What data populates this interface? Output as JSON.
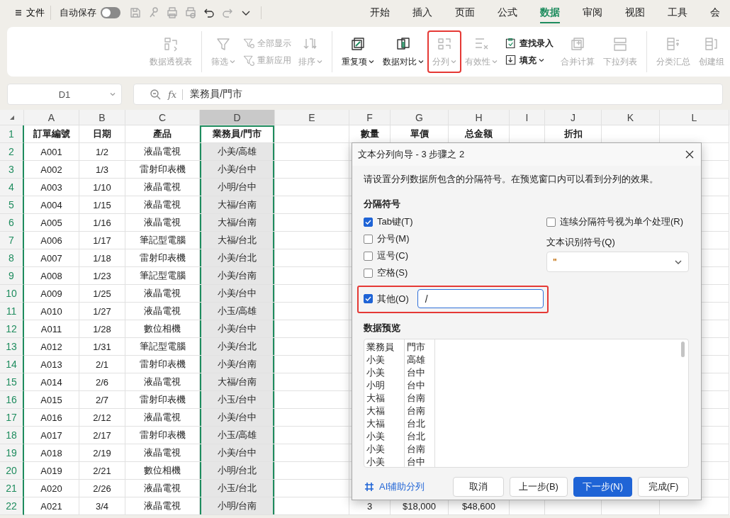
{
  "title_bar": {
    "file_label": "文件",
    "autosave": {
      "label": "自动保存",
      "on": false
    },
    "tabs": [
      {
        "label": "开始",
        "selected": false
      },
      {
        "label": "插入",
        "selected": false
      },
      {
        "label": "页面",
        "selected": false
      },
      {
        "label": "公式",
        "selected": false
      },
      {
        "label": "数据",
        "selected": true
      },
      {
        "label": "审阅",
        "selected": false
      },
      {
        "label": "视图",
        "selected": false
      },
      {
        "label": "工具",
        "selected": false
      },
      {
        "label": "会",
        "selected": false
      }
    ]
  },
  "ribbon": {
    "groups": [
      {
        "items": [
          {
            "kind": "large",
            "label": "数据透视表",
            "disabled": true,
            "caret": false,
            "highlighted": false
          }
        ]
      },
      {
        "items": [
          {
            "kind": "large",
            "label": "筛选",
            "disabled": true,
            "caret": true,
            "highlighted": false
          },
          {
            "kind": "stack",
            "entries": [
              {
                "label": "全部显示",
                "disabled": true,
                "caret": false
              },
              {
                "label": "重新应用",
                "disabled": true,
                "caret": false
              }
            ]
          },
          {
            "kind": "large",
            "label": "排序",
            "disabled": true,
            "caret": true,
            "highlighted": false
          }
        ]
      },
      {
        "items": [
          {
            "kind": "large",
            "label": "重复项",
            "disabled": false,
            "caret": true,
            "highlighted": false
          },
          {
            "kind": "large",
            "label": "数据对比",
            "disabled": false,
            "caret": true,
            "highlighted": false
          },
          {
            "kind": "large",
            "label": "分列",
            "disabled": true,
            "caret": true,
            "highlighted": true
          },
          {
            "kind": "large",
            "label": "有效性",
            "disabled": true,
            "caret": true,
            "highlighted": false
          },
          {
            "kind": "stack",
            "entries": [
              {
                "label": "查找录入",
                "disabled": false,
                "caret": false
              },
              {
                "label": "填充",
                "disabled": false,
                "caret": true
              }
            ]
          },
          {
            "kind": "large",
            "label": "合并计算",
            "disabled": true,
            "caret": false,
            "highlighted": false
          },
          {
            "kind": "large",
            "label": "下拉列表",
            "disabled": true,
            "caret": false,
            "highlighted": false
          }
        ]
      },
      {
        "items": [
          {
            "kind": "large",
            "label": "分类汇总",
            "disabled": true,
            "caret": false,
            "highlighted": false
          },
          {
            "kind": "large",
            "label": "创建组",
            "disabled": true,
            "caret": false,
            "highlighted": false
          }
        ]
      }
    ]
  },
  "formula_bar": {
    "cell_ref": "D1",
    "fx": "fx",
    "value": "業務員/門市"
  },
  "sheet": {
    "columns": [
      {
        "label": "A",
        "selected": false
      },
      {
        "label": "B",
        "selected": false
      },
      {
        "label": "C",
        "selected": false
      },
      {
        "label": "D",
        "selected": true
      },
      {
        "label": "E",
        "selected": false
      },
      {
        "label": "F",
        "selected": false
      },
      {
        "label": "G",
        "selected": false
      },
      {
        "label": "H",
        "selected": false
      },
      {
        "label": "I",
        "selected": false
      },
      {
        "label": "J",
        "selected": false
      },
      {
        "label": "K",
        "selected": false
      },
      {
        "label": "L",
        "selected": false
      }
    ],
    "rows": [
      {
        "number": "1",
        "cells": [
          "訂單編號",
          "日期",
          "產品",
          "業務員/門市",
          null,
          "數量",
          "單價",
          "总金额",
          null,
          "折扣"
        ]
      },
      {
        "number": "2",
        "cells": [
          "A001",
          "1/2",
          "液晶電視",
          "小美/高雄"
        ]
      },
      {
        "number": "3",
        "cells": [
          "A002",
          "1/3",
          "雷射印表機",
          "小美/台中"
        ]
      },
      {
        "number": "4",
        "cells": [
          "A003",
          "1/10",
          "液晶電視",
          "小明/台中"
        ]
      },
      {
        "number": "5",
        "cells": [
          "A004",
          "1/15",
          "液晶電視",
          "大福/台南"
        ]
      },
      {
        "number": "6",
        "cells": [
          "A005",
          "1/16",
          "液晶電視",
          "大福/台南"
        ]
      },
      {
        "number": "7",
        "cells": [
          "A006",
          "1/17",
          "筆記型電腦",
          "大福/台北"
        ]
      },
      {
        "number": "8",
        "cells": [
          "A007",
          "1/18",
          "雷射印表機",
          "小美/台北"
        ]
      },
      {
        "number": "9",
        "cells": [
          "A008",
          "1/23",
          "筆記型電腦",
          "小美/台南"
        ]
      },
      {
        "number": "10",
        "cells": [
          "A009",
          "1/25",
          "液晶電視",
          "小美/台中"
        ]
      },
      {
        "number": "11",
        "cells": [
          "A010",
          "1/27",
          "液晶電視",
          "小玉/高雄"
        ]
      },
      {
        "number": "12",
        "cells": [
          "A011",
          "1/28",
          "數位相機",
          "小美/台中"
        ]
      },
      {
        "number": "13",
        "cells": [
          "A012",
          "1/31",
          "筆記型電腦",
          "小美/台北"
        ]
      },
      {
        "number": "14",
        "cells": [
          "A013",
          "2/1",
          "雷射印表機",
          "小美/台南"
        ]
      },
      {
        "number": "15",
        "cells": [
          "A014",
          "2/6",
          "液晶電視",
          "大福/台南"
        ]
      },
      {
        "number": "16",
        "cells": [
          "A015",
          "2/7",
          "雷射印表機",
          "小玉/台中"
        ]
      },
      {
        "number": "17",
        "cells": [
          "A016",
          "2/12",
          "液晶電視",
          "小美/台中"
        ]
      },
      {
        "number": "18",
        "cells": [
          "A017",
          "2/17",
          "雷射印表機",
          "小玉/高雄"
        ]
      },
      {
        "number": "19",
        "cells": [
          "A018",
          "2/19",
          "液晶電視",
          "小美/台中"
        ]
      },
      {
        "number": "20",
        "cells": [
          "A019",
          "2/21",
          "數位相機",
          "小明/台北"
        ]
      },
      {
        "number": "21",
        "cells": [
          "A020",
          "2/26",
          "液晶電視",
          "小玉/台北"
        ]
      },
      {
        "number": "22",
        "cells": [
          "A021",
          "3/4",
          "液晶電視",
          "小明/台南",
          null,
          "3",
          "$18,000",
          "$48,600"
        ]
      }
    ]
  },
  "dialog": {
    "title": "文本分列向导 - 3 步骤之 2",
    "description": "请设置分列数据所包含的分隔符号。在预览窗口内可以看到分列的效果。",
    "delimiters_heading": "分隔符号",
    "delimiters": [
      {
        "label": "Tab键(T)",
        "checked": true,
        "highlighted": false
      },
      {
        "label": "分号(M)",
        "checked": false,
        "highlighted": false
      },
      {
        "label": "逗号(C)",
        "checked": false,
        "highlighted": false
      },
      {
        "label": "空格(S)",
        "checked": false,
        "highlighted": false
      },
      {
        "label": "其他(O)",
        "checked": true,
        "highlighted": true,
        "value": "/"
      }
    ],
    "consecutive": {
      "label": "连续分隔符号视为单个处理(R)",
      "checked": false
    },
    "qualifier": {
      "label": "文本识别符号(Q)",
      "value": "\""
    },
    "preview_heading": "数据预览",
    "preview_rows": [
      {
        "cells": [
          "業務員",
          "門市"
        ]
      },
      {
        "cells": [
          "小美",
          "高雄"
        ]
      },
      {
        "cells": [
          "小美",
          "台中"
        ]
      },
      {
        "cells": [
          "小明",
          "台中"
        ]
      },
      {
        "cells": [
          "大福",
          "台南"
        ]
      },
      {
        "cells": [
          "大福",
          "台南"
        ]
      },
      {
        "cells": [
          "大福",
          "台北"
        ]
      },
      {
        "cells": [
          "小美",
          "台北"
        ]
      },
      {
        "cells": [
          "小美",
          "台南"
        ]
      },
      {
        "cells": [
          "小美",
          "台中"
        ]
      }
    ],
    "ai_link": "AI辅助分列",
    "buttons": [
      {
        "label": "取消",
        "primary": false
      },
      {
        "label": "上一步(B)",
        "primary": false
      },
      {
        "label": "下一步(N)",
        "primary": true
      },
      {
        "label": "完成(F)",
        "primary": false
      }
    ]
  }
}
